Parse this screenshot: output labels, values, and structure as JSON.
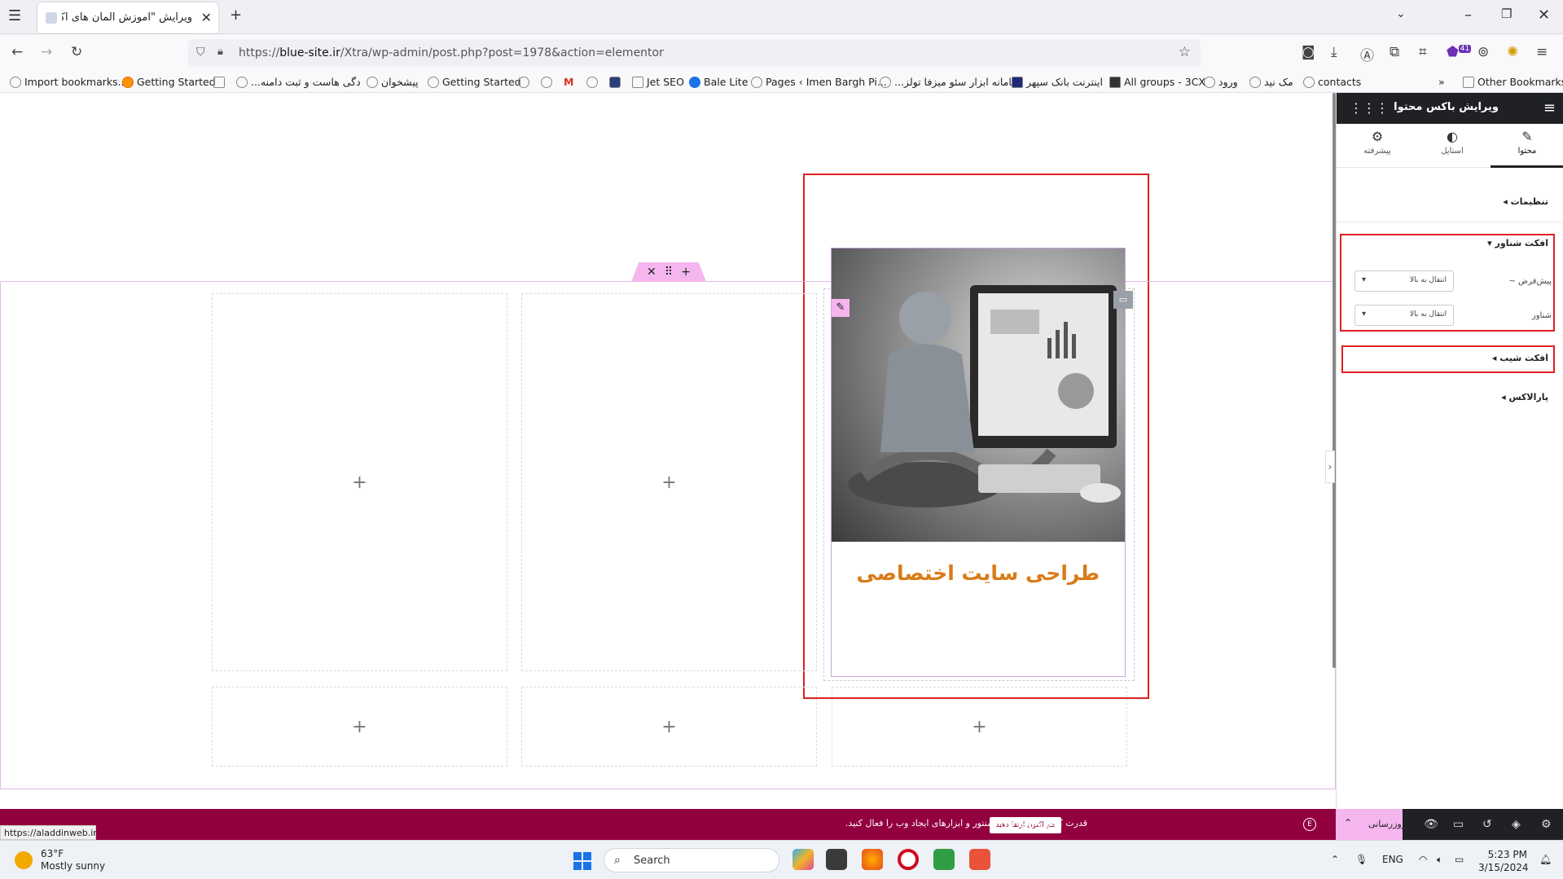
{
  "browser": {
    "tab_title": "ویرایش \"آموزش المان های اکسترا – ...",
    "url_prefix": "https://",
    "url_domain": "blue-site.ir",
    "url_path": "/Xtra/wp-admin/post.php?post=1978&action=elementor",
    "extensions_badge": "41"
  },
  "bookmarks": [
    "Import bookmarks...",
    "Getting Started",
    "...دگی هاست و ثبت دامنه",
    "پیشخوان",
    "Getting Started",
    "Jet SEO",
    "Bale Lite",
    "Pages ‹ Imen Bargh Pi...",
    "...سامانه ابزار سئو میزفا تولز",
    "اینترنت بانک سپهر",
    "All groups - 3CX",
    "ورود",
    "مک نید",
    "contacts",
    "Other Bookmarks"
  ],
  "canvas": {
    "card_title": "طراحی سایت اختصاصی",
    "image_alt": "genie-at-computer-image"
  },
  "panel": {
    "title": "ویرایش باکس محتوا",
    "tabs": [
      {
        "label": "محتوا",
        "icon": "pencil-icon"
      },
      {
        "label": "استایل",
        "icon": "contrast-icon"
      },
      {
        "label": "پیشرفته",
        "icon": "gear-icon"
      }
    ],
    "sections": {
      "settings": "تنظیمات",
      "float_effect": "افکت شناور",
      "tilt_effect": "افکت شیب",
      "parallax": "پارالاکس"
    },
    "float_rows": [
      {
        "label": "پیش‌فرض ~",
        "value": "انتقال به بالا"
      },
      {
        "label": "شناور",
        "value": "انتقال به بالا"
      }
    ]
  },
  "footer": {
    "promo_message": "قدرت کامل ویژگی های المنتور و ابزارهای ایجاد وب را فعال کنید.",
    "promo_button": "هم اکنون ارتقا دهید",
    "update_button": "بروزرسانی",
    "hover_url": "https://aladdinweb.ir"
  },
  "taskbar": {
    "temperature": "63°F",
    "weather": "Mostly sunny",
    "search_placeholder": "Search",
    "language": "ENG",
    "time": "5:23 PM",
    "date": "3/15/2024"
  }
}
